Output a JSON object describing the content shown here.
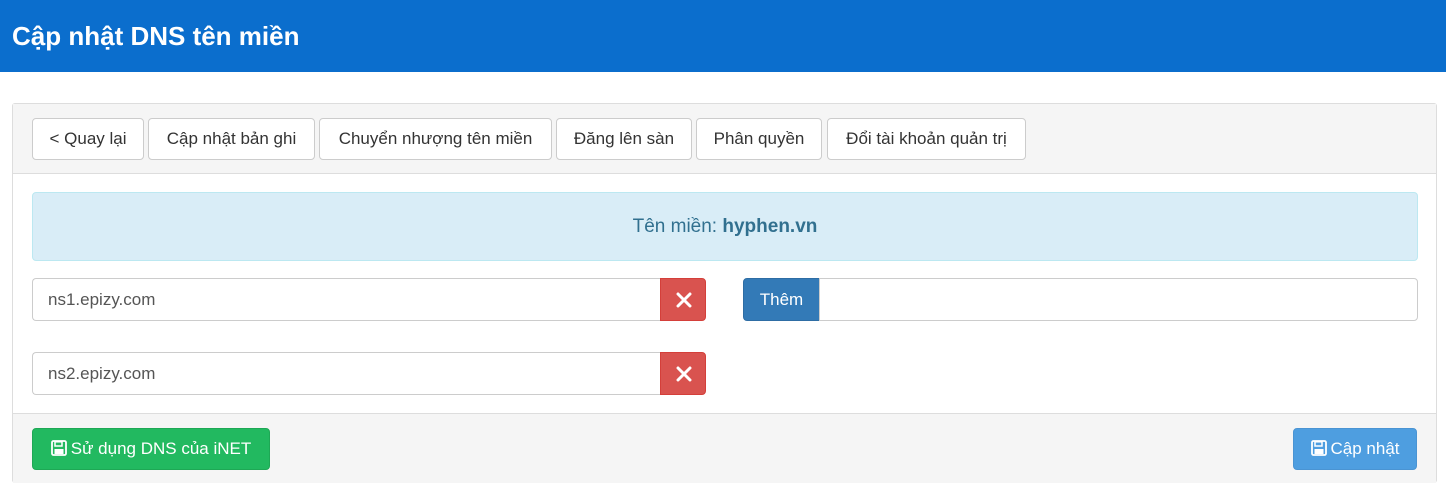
{
  "header": {
    "title": "Cập nhật DNS tên miền"
  },
  "toolbar": {
    "back_label": "< Quay lại",
    "update_records_label": "Cập nhật bản ghi",
    "transfer_label": "Chuyển nhượng tên miền",
    "list_label": "Đăng lên sàn",
    "permission_label": "Phân quyền",
    "change_admin_label": "Đổi tài khoản quản trị"
  },
  "domain_info": {
    "prefix": "Tên miền: ",
    "domain": "hyphen.vn"
  },
  "nameservers": [
    {
      "value": "ns1.epizy.com"
    },
    {
      "value": "ns2.epizy.com"
    }
  ],
  "add": {
    "label": "Thêm",
    "value": ""
  },
  "footer": {
    "use_inet_label": "Sử dụng DNS của iNET",
    "update_label": "Cập nhật"
  },
  "icons": {
    "delete": "close-icon",
    "save": "floppy-disk-icon"
  },
  "colors": {
    "header": "#0b6ecd",
    "danger": "#d9534f",
    "primary": "#337ab7",
    "success": "#22b960",
    "info": "#4e9ee0"
  }
}
